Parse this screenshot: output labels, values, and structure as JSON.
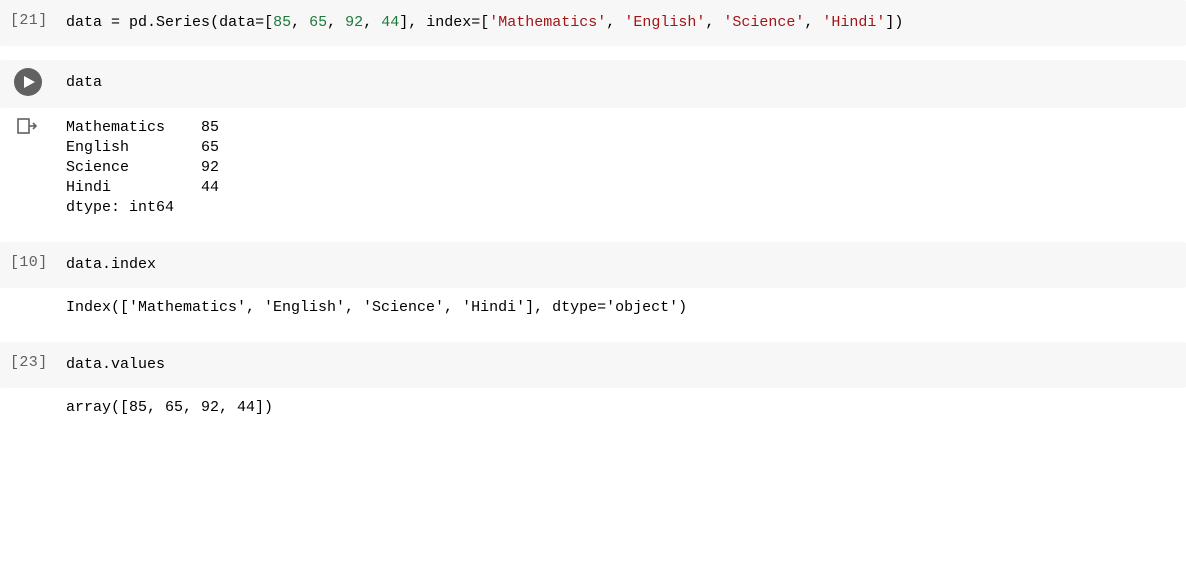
{
  "cells": [
    {
      "prompt": "[21]",
      "kind": "prompt",
      "tokens": [
        {
          "t": "data ",
          "cls": "var"
        },
        {
          "t": "= ",
          "cls": "op"
        },
        {
          "t": "pd.",
          "cls": "var"
        },
        {
          "t": "Series",
          "cls": "call"
        },
        {
          "t": "(",
          "cls": "punc"
        },
        {
          "t": "data",
          "cls": "var"
        },
        {
          "t": "=[",
          "cls": "punc"
        },
        {
          "t": "85",
          "cls": "num"
        },
        {
          "t": ", ",
          "cls": "punc"
        },
        {
          "t": "65",
          "cls": "num"
        },
        {
          "t": ", ",
          "cls": "punc"
        },
        {
          "t": "92",
          "cls": "num"
        },
        {
          "t": ", ",
          "cls": "punc"
        },
        {
          "t": "44",
          "cls": "num"
        },
        {
          "t": "], ",
          "cls": "punc"
        },
        {
          "t": "index",
          "cls": "var"
        },
        {
          "t": "=[",
          "cls": "punc"
        },
        {
          "t": "'Mathematics'",
          "cls": "str"
        },
        {
          "t": ", ",
          "cls": "punc"
        },
        {
          "t": "'English'",
          "cls": "str"
        },
        {
          "t": ", ",
          "cls": "punc"
        },
        {
          "t": "'Science'",
          "cls": "str"
        },
        {
          "t": ", ",
          "cls": "punc"
        },
        {
          "t": "'Hindi'",
          "cls": "str"
        },
        {
          "t": "])",
          "cls": "punc"
        }
      ],
      "output": ""
    },
    {
      "prompt": "",
      "kind": "play",
      "tokens": [
        {
          "t": "data",
          "cls": "var"
        }
      ],
      "output": "Mathematics    85\nEnglish        65\nScience        92\nHindi          44\ndtype: int64"
    },
    {
      "prompt": "[10]",
      "kind": "prompt",
      "tokens": [
        {
          "t": "data",
          "cls": "var"
        },
        {
          "t": ".",
          "cls": "punc"
        },
        {
          "t": "index",
          "cls": "var"
        }
      ],
      "output": "Index(['Mathematics', 'English', 'Science', 'Hindi'], dtype='object')"
    },
    {
      "prompt": "[23]",
      "kind": "prompt",
      "tokens": [
        {
          "t": "data",
          "cls": "var"
        },
        {
          "t": ".",
          "cls": "punc"
        },
        {
          "t": "values",
          "cls": "var"
        }
      ],
      "output": "array([85, 65, 92, 44])"
    }
  ]
}
